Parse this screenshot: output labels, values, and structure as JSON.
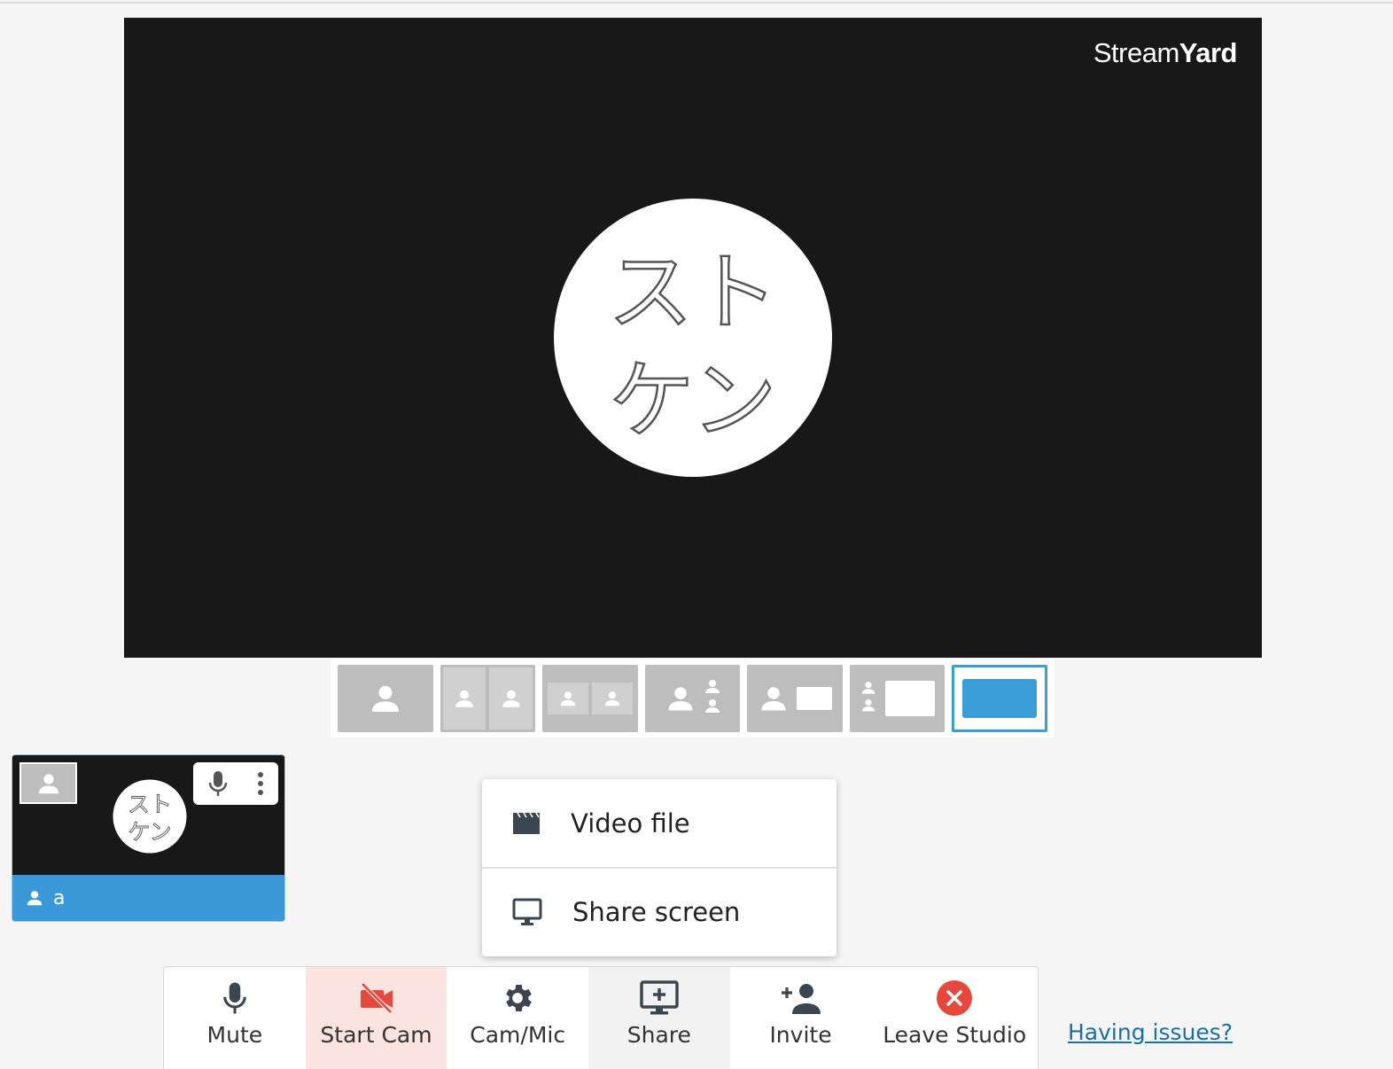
{
  "brand": {
    "name_light": "Stream",
    "name_bold": "Yard"
  },
  "avatar_text": [
    "スト",
    "ケン"
  ],
  "layouts": [
    {
      "icon": "solo-layout-icon",
      "active": false
    },
    {
      "icon": "split-layout-icon",
      "active": false
    },
    {
      "icon": "thin-split-layout-icon",
      "active": false
    },
    {
      "icon": "group-layout-icon",
      "active": false
    },
    {
      "icon": "leader-layout-icon",
      "active": false
    },
    {
      "icon": "sidebar-layout-icon",
      "active": false
    },
    {
      "icon": "fullscreen-layout-icon",
      "active": true
    }
  ],
  "participant": {
    "name": "a"
  },
  "share_menu": {
    "items": [
      {
        "label": "Video file",
        "icon": "clapperboard-icon"
      },
      {
        "label": "Share screen",
        "icon": "monitor-icon"
      }
    ]
  },
  "toolbar": {
    "mute_label": "Mute",
    "start_cam_label": "Start Cam",
    "cam_mic_label": "Cam/Mic",
    "share_label": "Share",
    "invite_label": "Invite",
    "leave_label": "Leave Studio"
  },
  "help_link": "Having issues?",
  "colors": {
    "accent": "#3a9ad9",
    "stage_bg": "#181818",
    "cam_off_bg": "#fbe3e0",
    "danger": "#e8473c",
    "link": "#1a6ea8"
  }
}
